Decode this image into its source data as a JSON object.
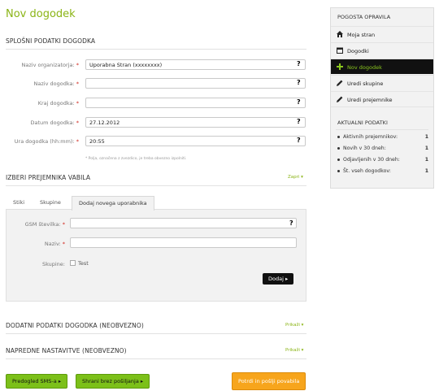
{
  "page": {
    "title": "Nov dogodek"
  },
  "section1": {
    "title": "SPLOŠNI PODATKI DOGODKA",
    "fields": [
      {
        "label": "Naziv organizatorja:",
        "value": "Uporabna Stran (xxxxxxxx)"
      },
      {
        "label": "Naziv dogodka:",
        "value": ""
      },
      {
        "label": "Kraj dogodka:",
        "value": ""
      },
      {
        "label": "Datum dogodka:",
        "value": "27.12.2012"
      },
      {
        "label": "Ura dogodka (hh:mm):",
        "value": "20:55"
      }
    ],
    "required_mark": "*",
    "help": "?",
    "note": "* Polja, označena z zvezdico, je treba obvezno izpolniti."
  },
  "section2": {
    "title": "IZBERI PREJEMNIKA VABILA",
    "toggle": "Zapri ▾",
    "tabs": [
      "Stiki",
      "Skupine",
      "Dodaj novega uporabnika"
    ],
    "fields": [
      {
        "label": "GSM številka:",
        "value": ""
      },
      {
        "label": "Naziv:",
        "value": ""
      }
    ],
    "group_label": "Skupine:",
    "group_option": "Test",
    "add_button": "Dodaj ▸"
  },
  "section3": {
    "title": "DODATNI PODATKI DOGODKA (NEOBVEZNO)",
    "toggle": "Prikaži ▾"
  },
  "section4": {
    "title": "NAPREDNE NASTAVITVE (NEOBVEZNO)",
    "toggle": "Prikaži ▾"
  },
  "actions": {
    "preview": "Predogled SMS-a ▸",
    "save": "Shrani brez pošiljanja ▸",
    "confirm": "Potrdi in pošlji povabila"
  },
  "sidebar": {
    "title": "POGOSTA OPRAVILA",
    "items": [
      {
        "label": "Moja stran",
        "icon": "home-icon"
      },
      {
        "label": "Dogodki",
        "icon": "calendar-icon"
      },
      {
        "label": "Nov dogodek",
        "icon": "plus-icon"
      },
      {
        "label": "Uredi skupine",
        "icon": "pencil-icon"
      },
      {
        "label": "Uredi prejemnike",
        "icon": "pencil-icon"
      }
    ],
    "stats_title": "AKTUALNI PODATKI",
    "stats": [
      {
        "label": "Aktivnih prejemnikov:",
        "value": "1"
      },
      {
        "label": "Novih v 30 dneh:",
        "value": "1"
      },
      {
        "label": "Odjavljenih v 30 dneh:",
        "value": "1"
      },
      {
        "label": "Št. vseh dogodkov:",
        "value": "1"
      }
    ]
  },
  "colors": {
    "accent": "#8ab415",
    "orange": "#f7a51c",
    "green_button": "#7cc019",
    "required": "#d0261c"
  }
}
